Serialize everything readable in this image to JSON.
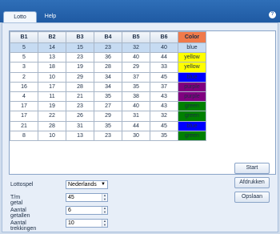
{
  "menu": {
    "tabs": [
      "Lotto",
      "Help"
    ],
    "help_icon": "?"
  },
  "grid": {
    "columns": [
      "B1",
      "B2",
      "B3",
      "B4",
      "B5",
      "B6",
      "Color"
    ],
    "rows": [
      {
        "nums": [
          "5",
          "14",
          "15",
          "23",
          "32",
          "40"
        ],
        "color": "blue",
        "color_hex": "#c6dbf2",
        "selected": true
      },
      {
        "nums": [
          "5",
          "13",
          "23",
          "36",
          "40",
          "44"
        ],
        "color": "yellow",
        "color_hex": "#ffff00",
        "selected": false
      },
      {
        "nums": [
          "3",
          "18",
          "19",
          "28",
          "29",
          "33"
        ],
        "color": "yellow",
        "color_hex": "#ffff00",
        "selected": false
      },
      {
        "nums": [
          "2",
          "10",
          "29",
          "34",
          "37",
          "45"
        ],
        "color": "blue",
        "color_hex": "#0000ff",
        "selected": false
      },
      {
        "nums": [
          "16",
          "17",
          "28",
          "34",
          "35",
          "37"
        ],
        "color": "purple",
        "color_hex": "#800080",
        "selected": false
      },
      {
        "nums": [
          "4",
          "11",
          "21",
          "35",
          "38",
          "43"
        ],
        "color": "purple",
        "color_hex": "#800080",
        "selected": false
      },
      {
        "nums": [
          "17",
          "19",
          "23",
          "27",
          "40",
          "43"
        ],
        "color": "green",
        "color_hex": "#008000",
        "selected": false
      },
      {
        "nums": [
          "17",
          "22",
          "26",
          "29",
          "31",
          "32"
        ],
        "color": "green",
        "color_hex": "#008000",
        "selected": false
      },
      {
        "nums": [
          "21",
          "28",
          "31",
          "35",
          "44",
          "45"
        ],
        "color": "blue",
        "color_hex": "#0000ff",
        "selected": false
      },
      {
        "nums": [
          "8",
          "10",
          "13",
          "23",
          "30",
          "35"
        ],
        "color": "green",
        "color_hex": "#008000",
        "selected": false
      }
    ]
  },
  "form": {
    "lottospel_label": "Lottospel",
    "lottospel_value": "Nederlands",
    "tm_label": "T/m getal",
    "tm_value": "45",
    "aantal_getallen_label": "Aantal getallen",
    "aantal_getallen_value": "6",
    "aantal_trekkingen_label": "Aantal trekkingen",
    "aantal_trekkingen_value": "10"
  },
  "buttons": {
    "start": "Start",
    "afdrukken": "Afdrukken",
    "opslaan": "Opslaan"
  }
}
